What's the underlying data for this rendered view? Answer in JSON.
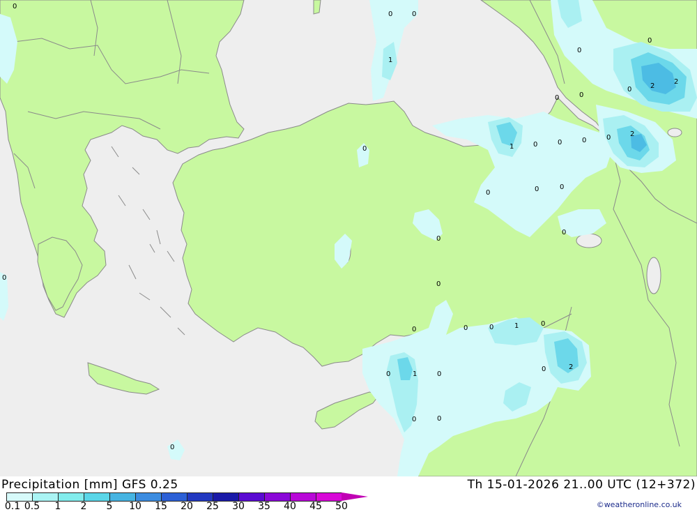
{
  "legend": {
    "title": "Precipitation [mm]  GFS 0.25",
    "datetime": "Th 15-01-2026 21..00 UTC (12+372)",
    "credit": "©weatheronline.co.uk",
    "scale_labels": [
      "0.1",
      "0.5",
      "1",
      "2",
      "5",
      "10",
      "15",
      "20",
      "25",
      "30",
      "35",
      "40",
      "45",
      "50"
    ],
    "scale_colors": [
      "#d7fafa",
      "#aaf4f4",
      "#82ecec",
      "#5ad6e8",
      "#46b4e2",
      "#3c8ce0",
      "#2c60d6",
      "#2238c0",
      "#1a1aa8",
      "#5a0ad2",
      "#8a08d8",
      "#b808d8",
      "#d808d8",
      "#c000b4"
    ]
  },
  "map": {
    "colors": {
      "sea": "#eeeeee",
      "land": "#c8f8a0",
      "border": "#8a8a8a",
      "precip_light": "#d4fafa",
      "precip_mid": "#aaf0f2",
      "precip_strong": "#6cd8ea",
      "precip_heavy": "#4cbce4"
    },
    "labels": [
      {
        "text": "0"
      },
      {
        "text": "0"
      },
      {
        "text": "0"
      },
      {
        "text": "1"
      },
      {
        "text": "0"
      },
      {
        "text": "0"
      },
      {
        "text": "2"
      },
      {
        "text": "2"
      },
      {
        "text": "0"
      },
      {
        "text": "0"
      },
      {
        "text": "0"
      },
      {
        "text": "0"
      },
      {
        "text": "1"
      },
      {
        "text": "0"
      },
      {
        "text": "0"
      },
      {
        "text": "0"
      },
      {
        "text": "0"
      },
      {
        "text": "2"
      },
      {
        "text": "0"
      },
      {
        "text": "0"
      },
      {
        "text": "0"
      },
      {
        "text": "0"
      },
      {
        "text": "0"
      },
      {
        "text": "0"
      },
      {
        "text": "0"
      },
      {
        "text": "0"
      },
      {
        "text": "0"
      },
      {
        "text": "1"
      },
      {
        "text": "0"
      },
      {
        "text": "0"
      },
      {
        "text": "2"
      },
      {
        "text": "0"
      },
      {
        "text": "1"
      },
      {
        "text": "0"
      },
      {
        "text": "0"
      },
      {
        "text": "0"
      },
      {
        "text": "0"
      }
    ]
  }
}
